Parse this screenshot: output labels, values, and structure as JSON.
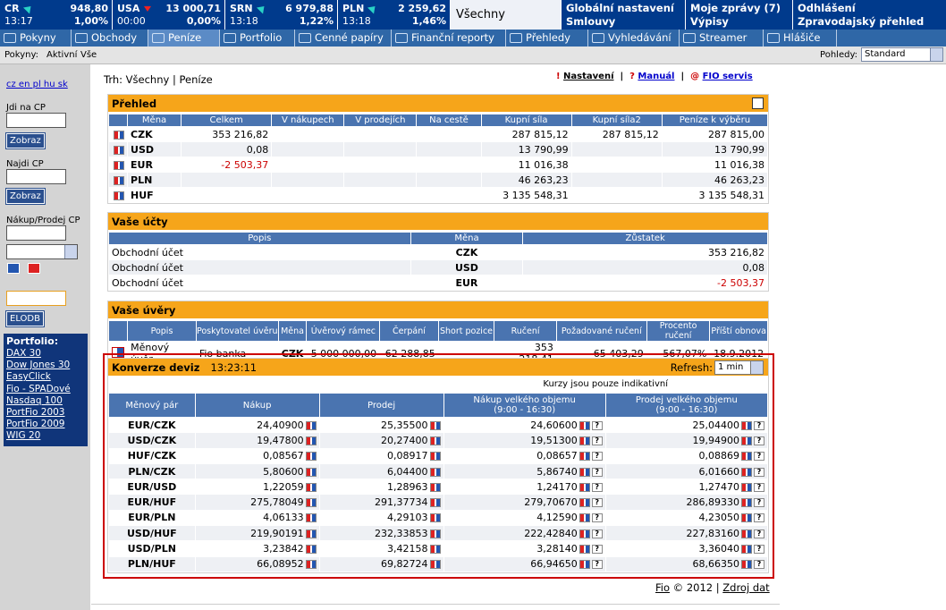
{
  "ticker": [
    {
      "name": "CR",
      "value": "948,80",
      "time": "13:17",
      "pct": "1,00%",
      "dir": "up"
    },
    {
      "name": "USA",
      "value": "13 000,71",
      "time": "00:00",
      "pct": "0,00%",
      "dir": "down"
    },
    {
      "name": "SRN",
      "value": "6 979,88",
      "time": "13:18",
      "pct": "1,22%",
      "dir": "up"
    },
    {
      "name": "PLN",
      "value": "2 259,62",
      "time": "13:18",
      "pct": "1,46%",
      "dir": "up"
    }
  ],
  "ticker_all": "Všechny",
  "top_links": [
    [
      "Globální nastavení",
      "Smlouvy"
    ],
    [
      "Moje zprávy (7)",
      "Výpisy"
    ],
    [
      "Odhlášení",
      "Zpravodajský přehled"
    ]
  ],
  "menu": [
    "Pokyny",
    "Obchody",
    "Peníze",
    "Portfolio",
    "Cenné papíry",
    "Finanční reporty",
    "Přehledy",
    "Vyhledávání",
    "Streamer",
    "Hlášiče"
  ],
  "sub": {
    "label": "Pokyny:",
    "items": [
      "Aktivní",
      "Vše"
    ],
    "pohledy": "Pohledy:",
    "pohledy_value": "Standard"
  },
  "left": {
    "langs": "cz en pl hu sk",
    "jdi": "Jdi na CP",
    "zobraz": "Zobraz",
    "najdi": "Najdi CP",
    "nakup": "Nákup/Prodej CP",
    "elodb": "ELODB",
    "portfolio_title": "Portfolio:",
    "portfolio": [
      "DAX 30",
      "Dow Jones 30",
      "EasyClick",
      "Fio - SPADové",
      "Nasdaq 100",
      "PortFio 2003",
      "PortFio 2009",
      "WIG 20"
    ]
  },
  "breadcrumb": "Trh: Všechny | Peníze",
  "toplinks": [
    "Nastavení",
    "Manuál",
    "FIO servis"
  ],
  "prehled": {
    "title": "Přehled",
    "headers": [
      "Měna",
      "Celkem",
      "V nákupech",
      "V prodejích",
      "Na cestě",
      "Kupní síla",
      "Kupní síla2",
      "Peníze k výběru"
    ],
    "rows": [
      [
        "CZK",
        "353 216,82",
        "",
        "",
        "",
        "287 815,12",
        "287 815,12",
        "287 815,00"
      ],
      [
        "USD",
        "0,08",
        "",
        "",
        "",
        "13 790,99",
        "",
        "13 790,99"
      ],
      [
        "EUR",
        "-2 503,37",
        "",
        "",
        "",
        "11 016,38",
        "",
        "11 016,38"
      ],
      [
        "PLN",
        "",
        "",
        "",
        "",
        "46 263,23",
        "",
        "46 263,23"
      ],
      [
        "HUF",
        "",
        "",
        "",
        "",
        "3 135 548,31",
        "",
        "3 135 548,31"
      ]
    ]
  },
  "ucty": {
    "title": "Vaše účty",
    "headers": [
      "Popis",
      "Měna",
      "Zůstatek"
    ],
    "rows": [
      [
        "Obchodní účet",
        "CZK",
        "353 216,82"
      ],
      [
        "Obchodní účet",
        "USD",
        "0,08"
      ],
      [
        "Obchodní účet",
        "EUR",
        "-2 503,37"
      ]
    ]
  },
  "uvery": {
    "title": "Vaše úvěry",
    "headers": [
      "Popis",
      "Poskytovatel úvěru",
      "Měna",
      "Úvěrový rámec",
      "Čerpání",
      "Short pozice",
      "Ručení",
      "Požadované ručení",
      "Procento ručení",
      "Příští obnova"
    ],
    "row": [
      "Měnový úvěr",
      "Fio banka",
      "CZK",
      "5 000 000,00",
      "62 288,85",
      "",
      "353 218,41",
      "65 403,29",
      "567,07%",
      "18.9.2012"
    ]
  },
  "konverze": {
    "title": "Konverze deviz",
    "time": "13:23:11",
    "refresh": "Refresh:",
    "refresh_value": "1 min",
    "note": "Kurzy jsou pouze indikativní",
    "headers": [
      "Měnový pár",
      "Nákup",
      "Prodej",
      "Nákup velkého objemu",
      "Prodej velkého objemu"
    ],
    "sub": "(9:00 - 16:30)",
    "rows": [
      [
        "EUR/CZK",
        "24,40900",
        "25,35500",
        "24,60600",
        "25,04400"
      ],
      [
        "USD/CZK",
        "19,47800",
        "20,27400",
        "19,51300",
        "19,94900"
      ],
      [
        "HUF/CZK",
        "0,08567",
        "0,08917",
        "0,08657",
        "0,08869"
      ],
      [
        "PLN/CZK",
        "5,80600",
        "6,04400",
        "5,86740",
        "6,01660"
      ],
      [
        "EUR/USD",
        "1,22059",
        "1,28963",
        "1,24170",
        "1,27470"
      ],
      [
        "EUR/HUF",
        "275,78049",
        "291,37734",
        "279,70670",
        "286,89330"
      ],
      [
        "EUR/PLN",
        "4,06133",
        "4,29103",
        "4,12590",
        "4,23050"
      ],
      [
        "USD/HUF",
        "219,90191",
        "232,33853",
        "222,42840",
        "227,83160"
      ],
      [
        "USD/PLN",
        "3,23842",
        "3,42158",
        "3,28140",
        "3,36040"
      ],
      [
        "PLN/HUF",
        "66,08952",
        "69,82724",
        "66,94650",
        "68,66350"
      ]
    ]
  },
  "footer": {
    "fio": "Fio",
    "copy": "© 2012 |",
    "source": "Zdroj dat"
  },
  "colors": {
    "navy": "#003a8c",
    "orange": "#f6a51a",
    "header": "#4a74b0",
    "highlight": "#cc0000"
  }
}
